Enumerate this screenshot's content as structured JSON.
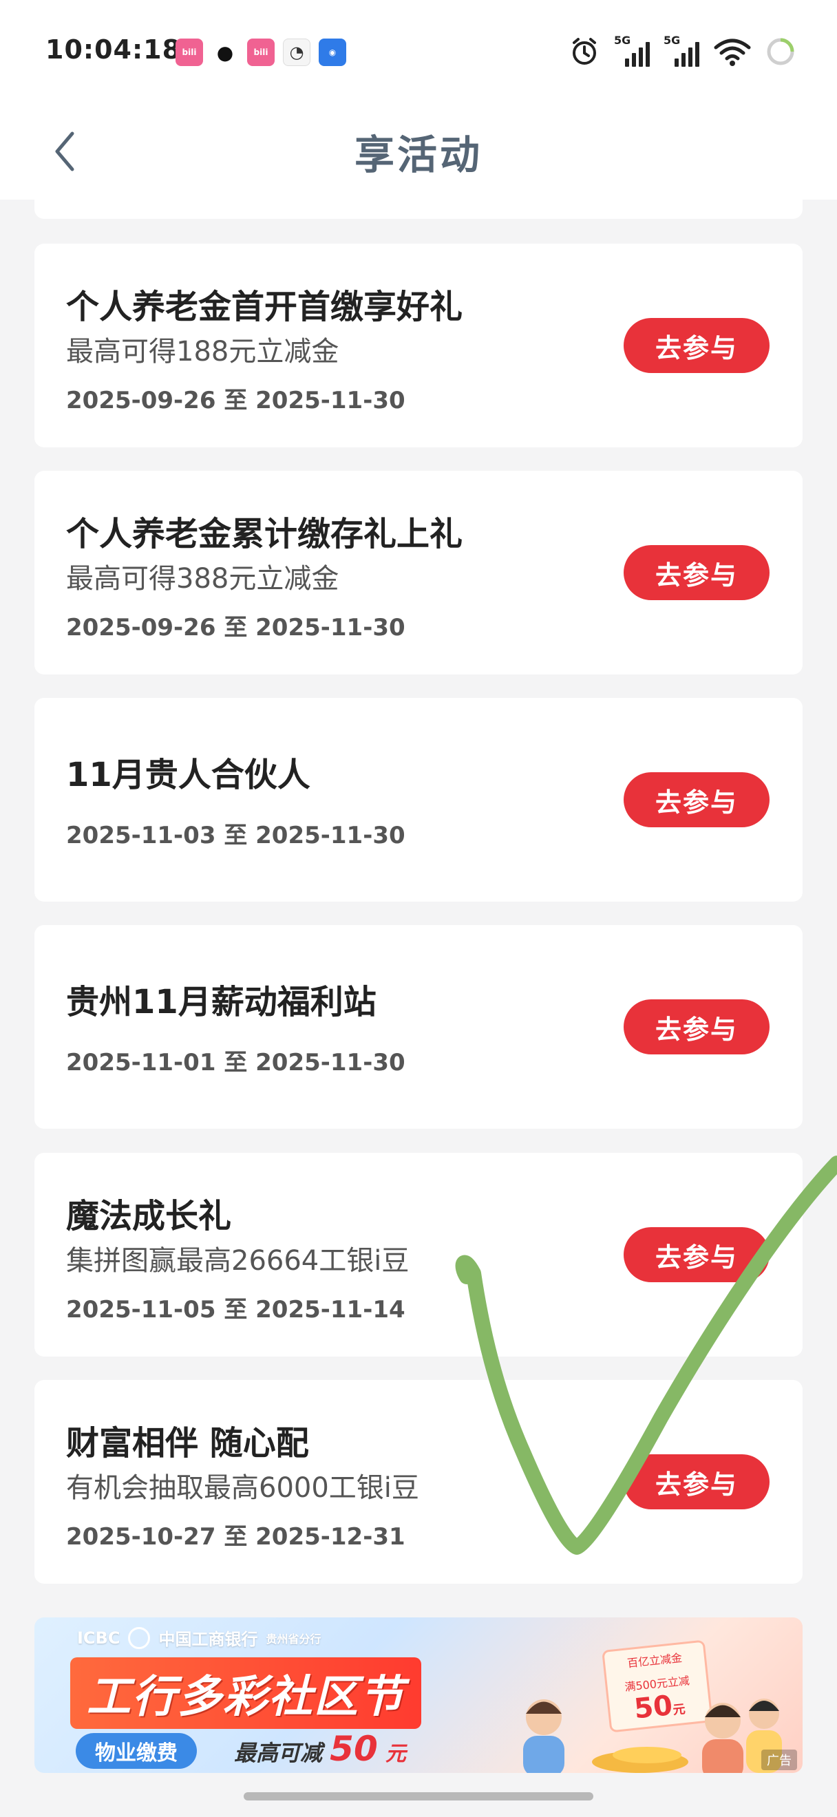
{
  "status": {
    "time": "10:04:18",
    "signal1": "5G",
    "signal2": "5G"
  },
  "header": {
    "title": "享活动"
  },
  "activities": [
    {
      "title": "个人养老金首开首缴享好礼",
      "subtitle": "最高可得188元立减金",
      "date": "2025-09-26 至 2025-11-30",
      "button": "去参与"
    },
    {
      "title": "个人养老金累计缴存礼上礼",
      "subtitle": "最高可得388元立减金",
      "date": "2025-09-26 至 2025-11-30",
      "button": "去参与"
    },
    {
      "title": "11月贵人合伙人",
      "subtitle": "",
      "date": "2025-11-03 至 2025-11-30",
      "button": "去参与"
    },
    {
      "title": "贵州11月薪动福利站",
      "subtitle": "",
      "date": "2025-11-01 至 2025-11-30",
      "button": "去参与"
    },
    {
      "title": "魔法成长礼",
      "subtitle": "集拼图赢最高26664工银i豆",
      "date": "2025-11-05 至 2025-11-14",
      "button": "去参与"
    },
    {
      "title": "财富相伴 随心配",
      "subtitle": "有机会抽取最高6000工银i豆",
      "date": "2025-10-27 至 2025-12-31",
      "button": "去参与"
    }
  ],
  "banner": {
    "logo": "ICBC",
    "bank_name": "中国工商银行",
    "branch": "贵州省分行",
    "headline": "工行多彩社区节",
    "pill": "物业缴费",
    "offer_prefix": "最高可减",
    "offer_amount": "50",
    "offer_unit": "元",
    "coupon_head": "百亿立减金",
    "coupon_line": "满500元立减",
    "coupon_amount": "50",
    "coupon_unit": "元",
    "ad_tag": "广告"
  },
  "colors": {
    "accent": "#e8323a",
    "title": "#556575",
    "checkmark": "#86b865"
  }
}
